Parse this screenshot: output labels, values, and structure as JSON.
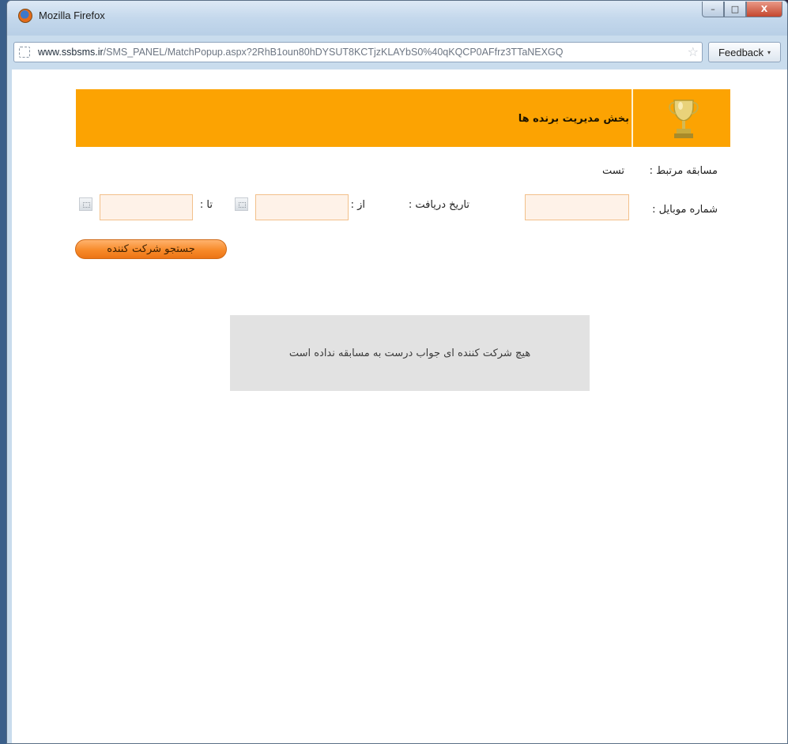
{
  "window": {
    "title": "Mozilla Firefox",
    "controls": {
      "minimize": "–",
      "maximize": "□",
      "close": "X"
    }
  },
  "browser": {
    "url_domain": "www.ssbsms.ir",
    "url_path": "/SMS_PANEL/MatchPopup.aspx?2RhB1oun80hDYSUT8KCTjzKLAYbS0%40qKQCP0AFfrz3TTaNEXGQ",
    "feedback_label": "Feedback",
    "feedback_arrow": "▾",
    "star_glyph": "☆"
  },
  "page": {
    "header_title": "بخش مدیریت برنده ها",
    "header_color": "#fca302",
    "contest_label": "مسابقه مرتبط :",
    "contest_value": "تست",
    "mobile_label": "شماره موبایل :",
    "mobile_value": "",
    "receive_date_label": "تاریخ دریافت :",
    "from_label": "از :",
    "from_value": "",
    "to_label": "تا :",
    "to_value": "",
    "search_button": "جستجو شرکت کننده",
    "empty_message": "هیچ شرکت کننده ای جواب درست به مسابقه نداده است"
  }
}
